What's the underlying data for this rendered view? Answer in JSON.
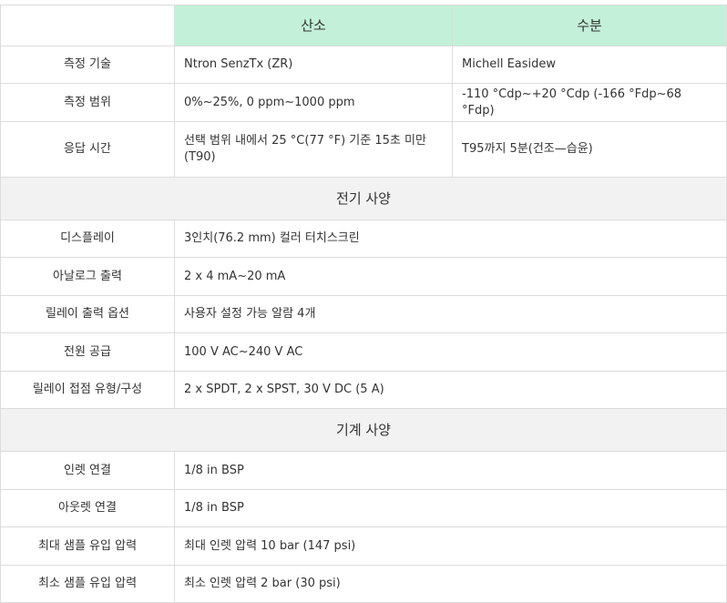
{
  "header": {
    "col_a": "산소",
    "col_b": "수분"
  },
  "measurement_rows": [
    {
      "label": "측정 기술",
      "a": "Ntron SenzTx (ZR)",
      "b": "Michell Easidew"
    },
    {
      "label": "측정 범위",
      "a": "0%~25%, 0 ppm~1000 ppm",
      "b": "-110 °Cdp~+20 °Cdp (-166 °Fdp~68 °Fdp)"
    },
    {
      "label": "응답 시간",
      "a": "선택 범위 내에서 25 °C(77 °F) 기준 15초 미만 (T90)",
      "b": "T95까지 5분(건조—습윤)"
    }
  ],
  "sections": {
    "electrical": "전기 사양",
    "mechanical": "기계 사양"
  },
  "electrical_rows": [
    {
      "label": "디스플레이",
      "value": "3인치(76.2 mm) 컬러 터치스크린"
    },
    {
      "label": "아날로그 출력",
      "value": "2 x 4 mA~20 mA"
    },
    {
      "label": "릴레이 출력 옵션",
      "value": "사용자 설정 가능 알람 4개"
    },
    {
      "label": "전원 공급",
      "value": "100 V AC~240 V AC"
    },
    {
      "label": "릴레이 접점 유형/구성",
      "value": "2 x SPDT, 2 x SPST, 30 V DC (5 A)"
    }
  ],
  "mechanical_rows": [
    {
      "label": "인렛 연결",
      "value": "1/8 in BSP"
    },
    {
      "label": "아웃렛 연결",
      "value": "1/8 in BSP"
    },
    {
      "label": "최대 샘플 유입 압력",
      "value": "최대 인렛 압력 10 bar (147 psi)"
    },
    {
      "label": "최소 샘플 유입 압력",
      "value": "최소 인렛 압력 2 bar (30 psi)"
    }
  ]
}
